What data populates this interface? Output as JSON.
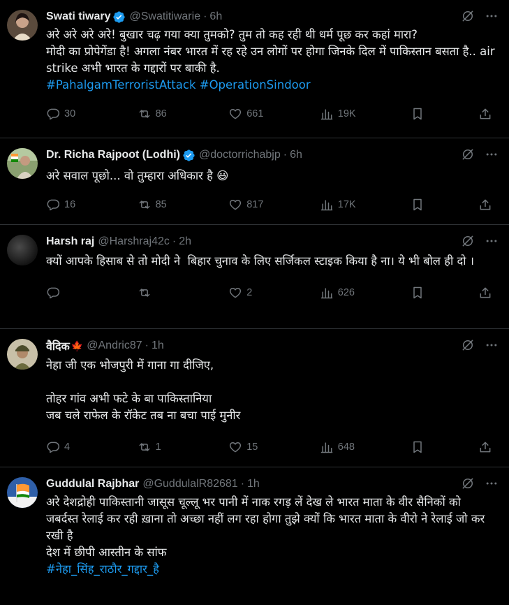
{
  "tweets": [
    {
      "name": "Swati tiwary",
      "verified": true,
      "flag": "",
      "handle": "@Swatitiwarie",
      "dot": "·",
      "time": "6h",
      "text": "अरे अरे अरे अरे! बुखार चढ़ गया क्या तुमको? तुम तो कह रही थी धर्म पूछ कर कहां मारा?\nमोदी का प्रोपेगेंडा है! अगला नंबर भारत में रह रहे उन लोगों पर होगा जिनके दिल में पाकिस्तान बसता है.. air strike अभी भारत के गद्दारों पर बाकी है.",
      "hashtags": "#PahalgamTerroristAttack #OperationSindoor",
      "replies": "30",
      "reposts": "86",
      "likes": "661",
      "views": "19K",
      "avatar_color": "#8a6a55"
    },
    {
      "name": "Dr. Richa Rajpoot (Lodhi)",
      "verified": true,
      "flag": "",
      "handle": "@doctorrichabjp",
      "dot": "·",
      "time": "6h",
      "text": "अरे सवाल पूछो... वो तुम्हारा अधिकार है 😃",
      "hashtags": "",
      "replies": "16",
      "reposts": "85",
      "likes": "817",
      "views": "17K",
      "avatar_color": "#6f8a5a"
    },
    {
      "name": "Harsh raj",
      "verified": false,
      "flag": "",
      "handle": "@Harshraj42c",
      "dot": "·",
      "time": "2h",
      "text": "क्यों आपके हिसाब से तो मोदी ने  बिहार चुनाव के लिए सर्जिकल स्टाइक किया है ना। ये भी बोल ही दो ।",
      "hashtags": "",
      "replies": "",
      "reposts": "",
      "likes": "2",
      "views": "626",
      "avatar_color": "#2b2b2b"
    },
    {
      "name": "वैदिक",
      "verified": false,
      "flag": "🍁",
      "handle": "@Andric87",
      "dot": "·",
      "time": "1h",
      "text": "नेहा जी एक भोजपुरी में गाना गा दीजिए,\n\nतोहर गांव अभी फटे के बा पाकिस्तानिया\nजब चले राफेल के रॉकेट तब ना बचा पाई मुनीर",
      "hashtags": "",
      "replies": "4",
      "reposts": "1",
      "likes": "15",
      "views": "648",
      "avatar_color": "#7a7a55"
    },
    {
      "name": "Guddulal Rajbhar",
      "verified": false,
      "flag": "",
      "handle": "@GuddulalR82681",
      "dot": "·",
      "time": "1h",
      "text": "अरे देशद्रोही पाकिस्तानी जासूस चूल्लू भर पानी में नाक रगड़ लें देख ले भारत माता के वीर सैनिकों को\nजबर्दस्त रेलाई कर रही ख़ाना तो अच्छा नहीं लग रहा होगा तुझे क्यों कि भारत माता के वीरो ने रेलाई जो कर रखी है\nदेश में छीपी आस्तीन के सांफ",
      "hashtags": "#नेहा_सिंह_राठौर_गद्दार_है",
      "replies": "",
      "reposts": "",
      "likes": "",
      "views": "",
      "avatar_color": "#3b5f9a"
    }
  ],
  "colors": {
    "accent": "#1d9bf0",
    "muted": "#71767b",
    "text": "#e7e9ea",
    "border": "#2f3336"
  }
}
